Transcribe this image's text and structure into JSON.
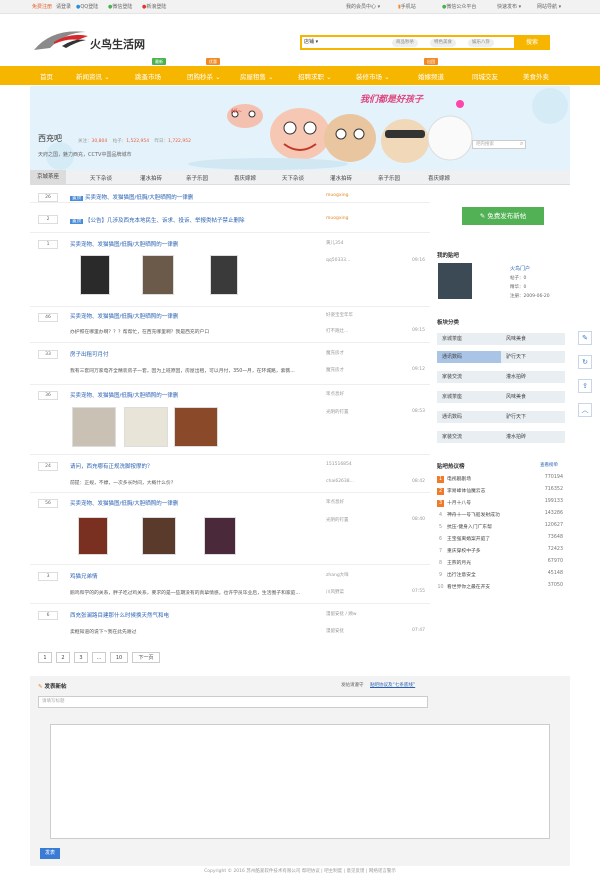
{
  "topbar": {
    "register": "免费注册",
    "login": "请登录",
    "qq": "QQ登陆",
    "weixin": "微信登陆",
    "weibo": "新浪登陆",
    "member": "我的会员中心 ▾",
    "mobile": "手机站",
    "wx_public": "微信公众平台",
    "publish": "快速发布 ▾",
    "nav": "网站导航 ▾"
  },
  "logo": {
    "text": "火鸟生活网"
  },
  "search": {
    "select": "店铺 ▾",
    "tags": [
      "商品秒杀",
      "特色美食",
      "娱乐八卦"
    ],
    "button": "搜索"
  },
  "nav": {
    "items": [
      "首页",
      "新闻资讯 ⌄",
      "跳蚤市场",
      "团购秒杀 ⌄",
      "房屋租售 ⌄",
      "招聘求职 ⌄",
      "装修市场 ⌄",
      "婚嫁频道",
      "同城交友",
      "美食外卖"
    ],
    "badges": [
      "最新",
      "优惠",
      "出团"
    ]
  },
  "banner": {
    "slogan": "我们都是好孩子",
    "hi": "Hi~"
  },
  "forum": {
    "name": "西充吧",
    "follow_label": "关注：",
    "follow": "30,804",
    "posts_label": "帖子：",
    "posts": "1,522,954",
    "today_label": "昨日：",
    "today": "1,722,952",
    "desc": "天府之国，魅力西充，CCTV中国品牌城市",
    "search_placeholder": "吧内搜索"
  },
  "tabs": [
    "京城茶座",
    "天下杂谈",
    "灌水拍砖",
    "亲子乐园",
    "喜庆嫁嫁",
    "天下杂谈",
    "灌水拍砖",
    "亲子乐园",
    "喜庆嫁嫁"
  ],
  "threads": [
    {
      "num": "26",
      "tag": "置顶",
      "title": "买卖宠物、发猫猫图/低胸/大胆晒照的一律删",
      "author": "muogxing",
      "time": ""
    },
    {
      "num": "2",
      "tag": "置顶",
      "title": "【公告】几涉及西充本地民生、诉求、投诉、举报类帖子禁止删除",
      "author": "muogxing",
      "time": ""
    },
    {
      "num": "1",
      "title": "买卖宠物、发猫猫图/低胸/大胆晒照的一律删",
      "author": "黄儿354",
      "author2": "qq50333...",
      "time": "09:16"
    },
    {
      "num": "46",
      "title": "买卖宠物、发猫猫图/低胸/大胆晒照的一律删",
      "excerpt": "办护照在哪里办啊？？？帮帮忙，在西充哪里啊？我是西充的户口",
      "author": "好姿宝宝年年",
      "author2": "打不跑灶...",
      "time": "09:15"
    },
    {
      "num": "33",
      "title": "房子出租可月付",
      "excerpt": "我有三套同万家电齐全精装房子一套，因为上班原因，房屋出租，可以月付，350一月，在环城路，紫薇...",
      "author": "魔充房才",
      "author2": "魔充房才",
      "time": "09:12"
    },
    {
      "num": "36",
      "title": "买卖宠物、发猫猫图/低胸/大胆晒照的一律删",
      "author": "笨点息好",
      "author2": "光阴的钉置",
      "time": "08:53"
    },
    {
      "num": "24",
      "title": "请问，西充哪有正规洗脚按摩的？",
      "excerpt": "前提：正规，不嫖，一次多长时间，大概什么价？",
      "author": "151516854",
      "author2": "chai62638...",
      "time": "08:42"
    },
    {
      "num": "56",
      "title": "买卖宠物、发猫猫图/低胸/大胆晒照的一律删",
      "author": "笨点息好",
      "author2": "光阴的钉置",
      "time": "08:40"
    },
    {
      "num": "3",
      "title": "鸡猫兄弟情",
      "excerpt": "鹅鸡和学的的关系，胖子吃过鸡关系，要求的是一些期没有的真挚情感。也许学员毕业后，生活圈子和家庭...",
      "author": "zhang大咩",
      "author2": "川风野菜",
      "time": "07:55"
    },
    {
      "num": "6",
      "title": "西充张澜路目建那什么时候换天然气和电",
      "excerpt": "卖框知道的说下~我在此先谢过",
      "author": "漫留安抚 / 顾w",
      "author2": "漫留安抚",
      "time": "07:47"
    }
  ],
  "pager": [
    "1",
    "2",
    "3",
    "...",
    "10",
    "下一页"
  ],
  "sidebar": {
    "post_button": "免费发布新帖",
    "my_forum": "我的贴吧",
    "user_name": "火鸟门户",
    "user_posts": "帖子：0",
    "user_best": "精华：0",
    "user_reg": "注册：2009-06-20",
    "board_title": "板块分类",
    "boards": [
      "京城茶座",
      "风味美食",
      "通讯数码",
      "驴行天下",
      "家装交流",
      "灌水拍砖",
      "京城茶座",
      "风味美食",
      "通讯数码",
      "驴行天下",
      "家装交流",
      "灌水拍砖"
    ],
    "hot_title": "贴吧热议榜",
    "hot_more": "查看榜单",
    "hot": [
      [
        "电视剧剧场",
        "770194"
      ],
      [
        "李易峰体仙魔云志",
        "716352"
      ],
      [
        "十月十八号",
        "199133"
      ],
      [
        "神舟十一号飞船发射成功",
        "143286"
      ],
      [
        "抗压-健身入门广东帮",
        "120627"
      ],
      [
        "王宝强离婚案开庭了",
        "73648"
      ],
      [
        "重庆穿校中子多",
        "72423"
      ],
      [
        "王燕的月光",
        "67970"
      ],
      [
        "出行注意安全",
        "45148"
      ],
      [
        "看世界你之最在开支",
        "37050"
      ]
    ]
  },
  "reply": {
    "title": "发表新帖",
    "notice": "发帖请遵守",
    "agreement": "贴吧协议及“七条底线”",
    "title_placeholder": "请填写标题",
    "submit": "发表"
  },
  "footer": {
    "text": "Copyright © 2016 苏州酷爱软件技术有限公司   帮吧协议  |  吧主制度  |  意见反馈  |  网络谣言警示"
  }
}
